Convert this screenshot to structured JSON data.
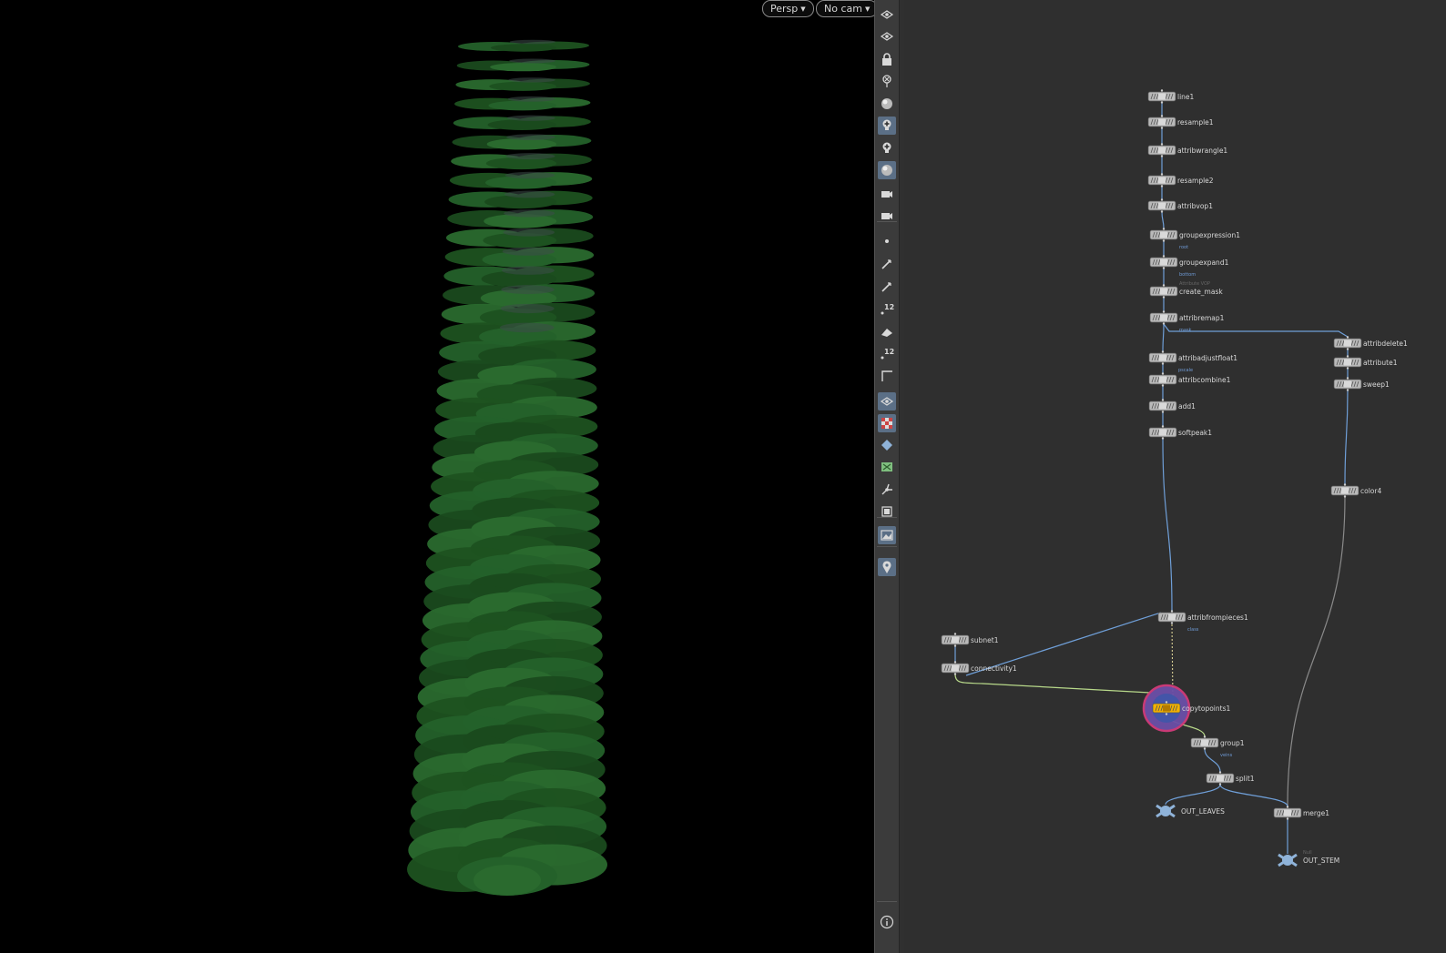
{
  "viewport": {
    "projection_menu": "Persp",
    "camera_menu": "No cam",
    "background_color": "#000000",
    "leaf_color": "#1f5a22"
  },
  "toolbar": {
    "buttons": [
      {
        "icon": "display-options-icon",
        "active": false
      },
      {
        "icon": "ghost-other-objects-icon",
        "active": false
      },
      {
        "icon": "lock-icon",
        "active": false
      },
      {
        "icon": "pin-icon",
        "active": false
      },
      {
        "icon": "sphere-shading-icon",
        "active": false
      },
      {
        "icon": "add-light-icon",
        "active": true
      },
      {
        "icon": "light-options-icon",
        "active": false
      },
      {
        "icon": "environment-icon",
        "active": true
      },
      {
        "icon": "camera-view-icon",
        "active": false
      },
      {
        "icon": "camera-snapshot-icon",
        "active": false
      },
      {
        "icon": "point-display-icon",
        "active": false
      },
      {
        "icon": "normals-icon",
        "active": false
      },
      {
        "icon": "brush-icon",
        "active": false
      },
      {
        "icon": "point-numbers-icon",
        "active": false,
        "text": "12"
      },
      {
        "icon": "primitive-display-icon",
        "active": false
      },
      {
        "icon": "primitive-numbers-icon",
        "active": false,
        "text": "12"
      },
      {
        "icon": "grid-corner-icon",
        "active": false
      },
      {
        "icon": "wireframe-icon",
        "active": true
      },
      {
        "icon": "checker-icon",
        "active": true
      },
      {
        "icon": "diamond-icon",
        "active": false
      },
      {
        "icon": "uv-icon",
        "active": false
      },
      {
        "icon": "snapping-icon",
        "active": false
      },
      {
        "icon": "render-region-icon",
        "active": false
      },
      {
        "icon": "background-image-icon",
        "active": true
      },
      {
        "icon": "location-icon",
        "active": true
      },
      {
        "icon": "info-icon",
        "active": false
      }
    ]
  },
  "network": {
    "nodes": [
      {
        "id": "line1",
        "label": "line1",
        "tag": "",
        "sub": ""
      },
      {
        "id": "resample1",
        "label": "resample1",
        "tag": "",
        "sub": ""
      },
      {
        "id": "attribwrangle1",
        "label": "attribwrangle1",
        "tag": "",
        "sub": ""
      },
      {
        "id": "resample2",
        "label": "resample2",
        "tag": "",
        "sub": ""
      },
      {
        "id": "attribvop1",
        "label": "attribvop1",
        "tag": "",
        "sub": ""
      },
      {
        "id": "groupexpression1",
        "label": "groupexpression1",
        "tag": "root",
        "sub": ""
      },
      {
        "id": "groupexpand1",
        "label": "groupexpand1",
        "tag": "bottom",
        "sub": ""
      },
      {
        "id": "create_mask",
        "label": "create_mask",
        "tag": "",
        "sub": "Attribute VOP"
      },
      {
        "id": "attribremap1",
        "label": "attribremap1",
        "tag": "mask",
        "sub": ""
      },
      {
        "id": "attribadjustfloat1",
        "label": "attribadjustfloat1",
        "tag": "pscale",
        "sub": ""
      },
      {
        "id": "attribcombine1",
        "label": "attribcombine1",
        "tag": "",
        "sub": ""
      },
      {
        "id": "add1",
        "label": "add1",
        "tag": "",
        "sub": ""
      },
      {
        "id": "softpeak1",
        "label": "softpeak1",
        "tag": "",
        "sub": ""
      },
      {
        "id": "attribdelete1",
        "label": "attribdelete1",
        "tag": "",
        "sub": ""
      },
      {
        "id": "attribute1",
        "label": "attribute1",
        "tag": "",
        "sub": ""
      },
      {
        "id": "sweep1",
        "label": "sweep1",
        "tag": "",
        "sub": ""
      },
      {
        "id": "color4",
        "label": "color4",
        "tag": "",
        "sub": ""
      },
      {
        "id": "attribfrompieces1",
        "label": "attribfrompieces1",
        "tag": "class",
        "sub": ""
      },
      {
        "id": "subnet1",
        "label": "subnet1",
        "tag": "",
        "sub": ""
      },
      {
        "id": "connectivity1",
        "label": "connectivity1",
        "tag": "",
        "sub": ""
      },
      {
        "id": "copytopoints1",
        "label": "copytopoints1",
        "tag": "",
        "sub": ""
      },
      {
        "id": "group1",
        "label": "group1",
        "tag": "veins",
        "sub": ""
      },
      {
        "id": "split1",
        "label": "split1",
        "tag": "",
        "sub": ""
      },
      {
        "id": "out_leaves",
        "label": "OUT_LEAVES",
        "tag": "",
        "sub": ""
      },
      {
        "id": "merge1",
        "label": "merge1",
        "tag": "",
        "sub": ""
      },
      {
        "id": "out_stem",
        "label": "OUT_STEM",
        "tag": "",
        "sub": "Null"
      }
    ],
    "colors": {
      "wire": "#6f9fd8",
      "wire_green": "#b8d98a",
      "wire_gray": "#8a8a8a",
      "node_fill": "#b9b9b9",
      "display_flag": "#f2b100",
      "selection_ring": "#d23b7a"
    }
  }
}
